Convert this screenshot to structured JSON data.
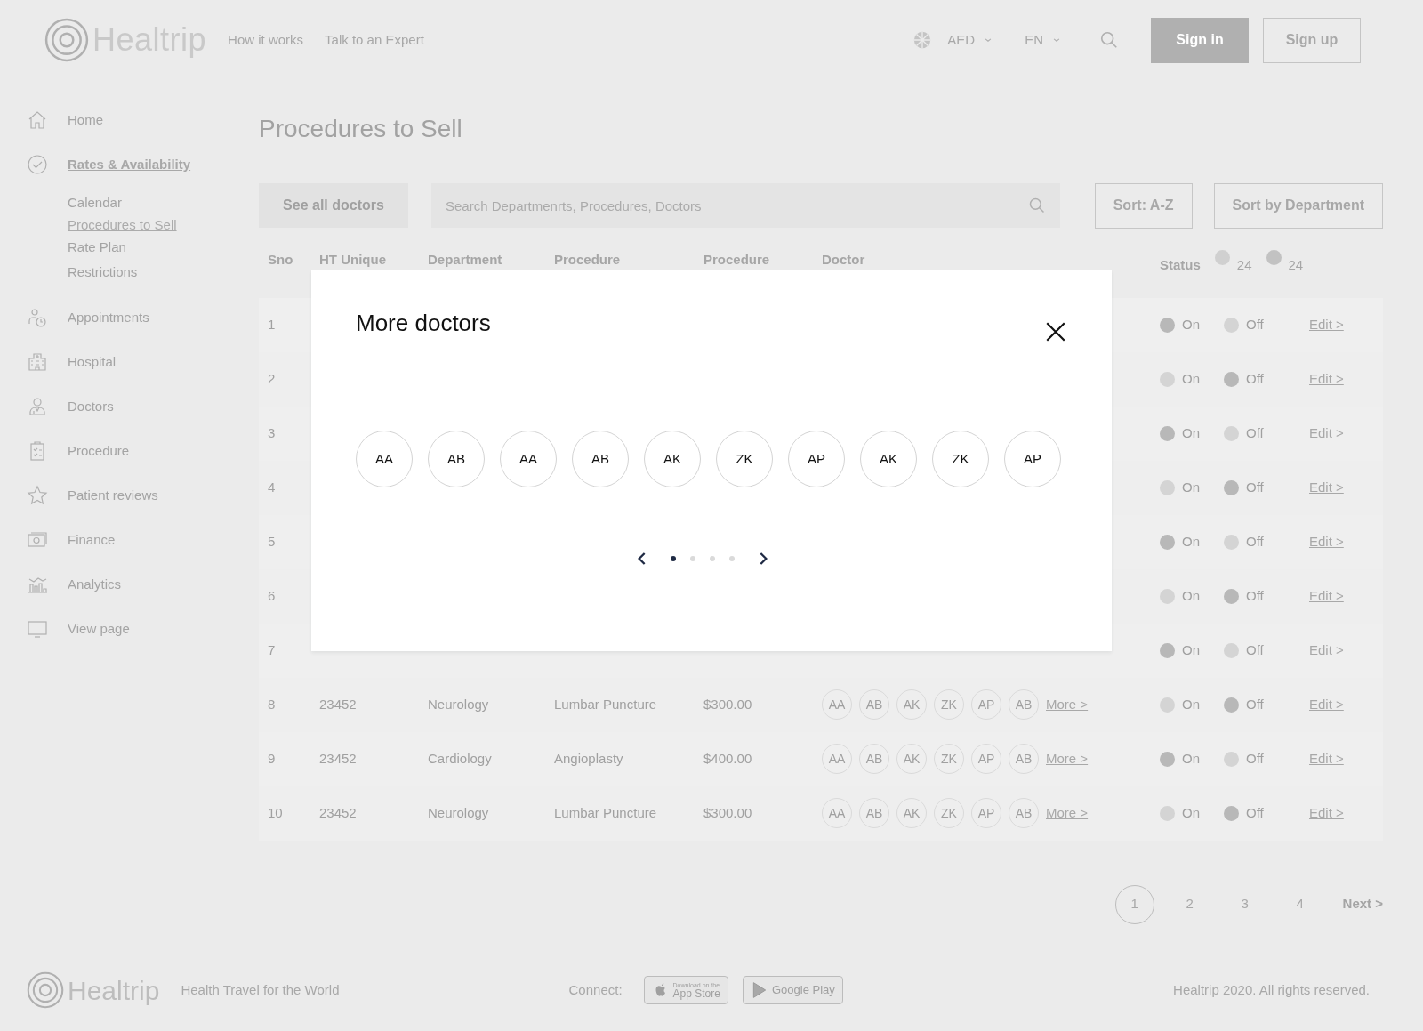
{
  "header": {
    "logo": "Healtrip",
    "nav": [
      "How it works",
      "Talk to an Expert"
    ],
    "currency": "AED",
    "language": "EN",
    "sign_in": "Sign in",
    "sign_up": "Sign up"
  },
  "sidebar": {
    "items": [
      {
        "label": "Home",
        "selected": false
      },
      {
        "label": "Rates & Availability",
        "selected": true,
        "children": [
          {
            "label": "Calendar",
            "selected": false
          },
          {
            "label": "Procedures to Sell",
            "selected": true
          },
          {
            "label": "Rate Plan",
            "selected": false
          },
          {
            "label": "Restrictions",
            "selected": false
          }
        ]
      },
      {
        "label": "Appointments",
        "selected": false
      },
      {
        "label": "Hospital",
        "selected": false
      },
      {
        "label": "Doctors",
        "selected": false
      },
      {
        "label": "Procedure",
        "selected": false
      },
      {
        "label": "Patient reviews",
        "selected": false
      },
      {
        "label": "Finance",
        "selected": false
      },
      {
        "label": "Analytics",
        "selected": false
      },
      {
        "label": "View page",
        "selected": false
      }
    ]
  },
  "page_title": "Procedures to Sell",
  "toolbar": {
    "see_all": "See all doctors",
    "search": {
      "placeholder": "Search Departmenrts, Procedures, Doctors"
    },
    "sort_buttons": [
      "Sort: A-Z",
      "Sort by Department"
    ]
  },
  "table": {
    "columns": [
      "Sno",
      "HT Unique",
      "Department",
      "Procedure",
      "Procedure",
      "Doctor"
    ],
    "status": {
      "label": "Status",
      "legend": [
        {
          "count": "24",
          "color": "#d0d0d0"
        },
        {
          "count": "24",
          "color": "#c2c2c2"
        }
      ]
    },
    "rows": [
      {
        "sno": "1",
        "on": true,
        "on_label": "On",
        "off_label": "Off",
        "edit": "Edit >"
      },
      {
        "sno": "2",
        "on": false,
        "on_label": "On",
        "off_label": "Off",
        "edit": "Edit >"
      },
      {
        "sno": "3",
        "on": true,
        "on_label": "On",
        "off_label": "Off",
        "edit": "Edit >"
      },
      {
        "sno": "4",
        "on": false,
        "on_label": "On",
        "off_label": "Off",
        "edit": "Edit >"
      },
      {
        "sno": "5",
        "on": true,
        "on_label": "On",
        "off_label": "Off",
        "edit": "Edit >"
      },
      {
        "sno": "6",
        "on": false,
        "on_label": "On",
        "off_label": "Off",
        "edit": "Edit >"
      },
      {
        "sno": "7",
        "on": true,
        "on_label": "On",
        "off_label": "Off",
        "edit": "Edit >"
      },
      {
        "sno": "8",
        "ht": "23452",
        "department": "Neurology",
        "procedure": "Lumbar Puncture",
        "price": "$300.00",
        "doctors": [
          "AA",
          "AB",
          "AK",
          "ZK",
          "AP",
          "AB"
        ],
        "more": "More >",
        "on": false,
        "on_label": "On",
        "off_label": "Off",
        "edit": "Edit >"
      },
      {
        "sno": "9",
        "ht": "23452",
        "department": "Cardiology",
        "procedure": "Angioplasty",
        "price": "$400.00",
        "doctors": [
          "AA",
          "AB",
          "AK",
          "ZK",
          "AP",
          "AB"
        ],
        "more": "More >",
        "on": true,
        "on_label": "On",
        "off_label": "Off",
        "edit": "Edit >"
      },
      {
        "sno": "10",
        "ht": "23452",
        "department": "Neurology",
        "procedure": "Lumbar Puncture",
        "price": "$300.00",
        "doctors": [
          "AA",
          "AB",
          "AK",
          "ZK",
          "AP",
          "AB"
        ],
        "more": "More >",
        "on": false,
        "on_label": "On",
        "off_label": "Off",
        "edit": "Edit >"
      }
    ]
  },
  "pagination": {
    "pages": [
      {
        "label": "1",
        "selected": true
      },
      {
        "label": "2",
        "selected": false
      },
      {
        "label": "3",
        "selected": false
      },
      {
        "label": "4",
        "selected": false
      }
    ],
    "next": "Next >"
  },
  "modal": {
    "title": "More doctors",
    "doctors": [
      "AA",
      "AB",
      "AA",
      "AB",
      "AK",
      "ZK",
      "AP",
      "AK",
      "ZK",
      "AP"
    ],
    "pages": [
      {
        "selected": true
      },
      {
        "selected": false
      },
      {
        "selected": false
      },
      {
        "selected": false
      }
    ]
  },
  "footer": {
    "logo": "Healtrip",
    "tagline": "Health Travel for the World",
    "connect": "Connect:",
    "app_store": {
      "small": "Download on the",
      "big": "App Store"
    },
    "google_play": {
      "big": "Google Play"
    },
    "copyright": "Healtrip 2020. All rights reserved."
  }
}
